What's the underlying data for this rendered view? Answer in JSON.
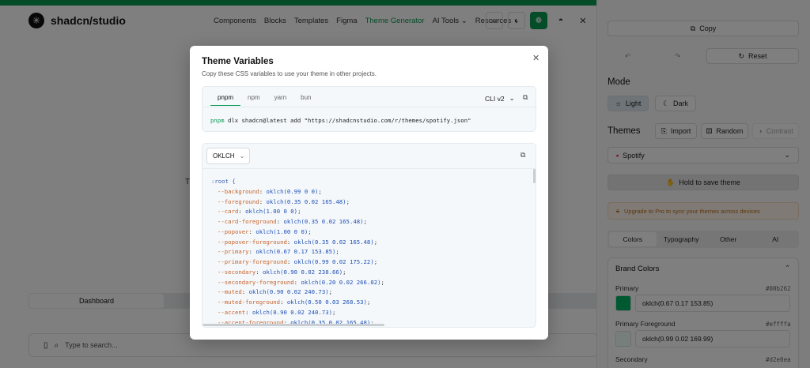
{
  "app": {
    "logo_glyph": "✳",
    "logo_text": "shadcn/studio",
    "nav": [
      "Components",
      "Blocks",
      "Templates",
      "Figma",
      "Theme Generator",
      "AI Tools ⌄",
      "Resources ⌄"
    ],
    "nav_active_index": 4,
    "accent_color": "#0a9a52",
    "bg_text": "T",
    "tabs": [
      "Dashboard"
    ],
    "search_placeholder": "Type to search..."
  },
  "right_panel": {
    "copy_label": "Copy",
    "reset_label": "Reset",
    "mode_heading": "Mode",
    "mode_light": "Light",
    "mode_dark": "Dark",
    "themes_heading": "Themes",
    "import_label": "Import",
    "random_label": "Random",
    "contrast_label": "Contrast",
    "theme_selected": "Spotify",
    "hold_label": "Hold to save theme",
    "promo_text": "Upgrade to Pro to sync your themes across devices",
    "tabs": [
      "Colors",
      "Typography",
      "Other",
      "AI"
    ],
    "brand_heading": "Brand Colors",
    "colors": [
      {
        "name": "Primary",
        "hex": "#00b262",
        "value": "oklch(0.67 0.17 153.85)",
        "swatch": "#00b262"
      },
      {
        "name": "Primary Foreground",
        "hex": "#effffa",
        "value": "oklch(0.99 0.02 169.99)",
        "swatch": "#effffa"
      },
      {
        "name": "Secondary",
        "hex": "#d2e0ea"
      }
    ]
  },
  "modal": {
    "title": "Theme Variables",
    "description": "Copy these CSS variables to use your theme in other projects.",
    "package_managers": [
      "pnpm",
      "npm",
      "yarn",
      "bun"
    ],
    "active_pm": 0,
    "cli_version": "CLI v2",
    "command_kw": "pnpm",
    "command_rest": " dlx shadcn@latest add \"https://shadcnstudio.com/r/themes/spotify.json\"",
    "format": "OKLCH",
    "selector": ":root {",
    "variables": [
      {
        "name": "--background",
        "value": "oklch(0.99 0 0)"
      },
      {
        "name": "--foreground",
        "value": "oklch(0.35 0.02 165.48)"
      },
      {
        "name": "--card",
        "value": "oklch(1.00 0 0)"
      },
      {
        "name": "--card-foreground",
        "value": "oklch(0.35 0.02 165.48)"
      },
      {
        "name": "--popover",
        "value": "oklch(1.00 0 0)"
      },
      {
        "name": "--popover-foreground",
        "value": "oklch(0.35 0.02 165.48)"
      },
      {
        "name": "--primary",
        "value": "oklch(0.67 0.17 153.85)"
      },
      {
        "name": "--primary-foreground",
        "value": "oklch(0.99 0.02 175.22)"
      },
      {
        "name": "--secondary",
        "value": "oklch(0.90 0.02 238.66)"
      },
      {
        "name": "--secondary-foreground",
        "value": "oklch(0.20 0.02 266.02)"
      },
      {
        "name": "--muted",
        "value": "oklch(0.90 0.02 240.73)"
      },
      {
        "name": "--muted-foreground",
        "value": "oklch(0.50 0.03 268.53)"
      },
      {
        "name": "--accent",
        "value": "oklch(0.90 0.02 240.73)"
      },
      {
        "name": "--accent-foreground",
        "value": "oklch(0.35 0.02 165.48)"
      }
    ]
  }
}
